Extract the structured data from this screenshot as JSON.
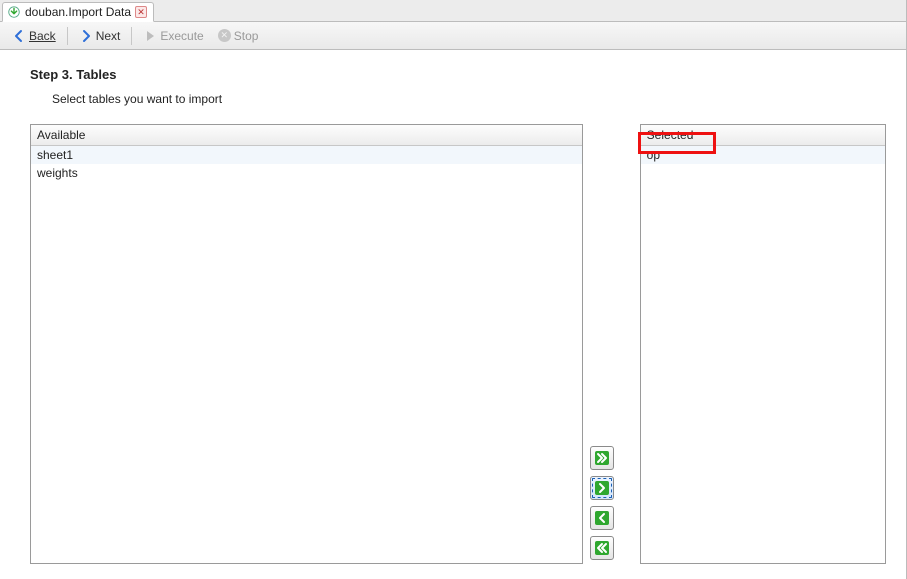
{
  "tab": {
    "title": "douban.Import Data"
  },
  "toolbar": {
    "back": "Back",
    "next": "Next",
    "execute": "Execute",
    "stop": "Stop"
  },
  "wizard": {
    "step_title": "Step 3. Tables",
    "step_desc": "Select tables you want to import"
  },
  "lists": {
    "available_header": "Available",
    "selected_header": "Selected",
    "available_items": [
      "sheet1",
      "weights"
    ],
    "selected_items": [
      "op"
    ]
  },
  "transfer_buttons": {
    "add_all": "add-all",
    "add_one": "add-one",
    "remove_one": "remove-one",
    "remove_all": "remove-all"
  },
  "colors": {
    "arrow_blue": "#2e6fd8",
    "arrow_green": "#2fa72f",
    "highlight_red": "#e11"
  }
}
